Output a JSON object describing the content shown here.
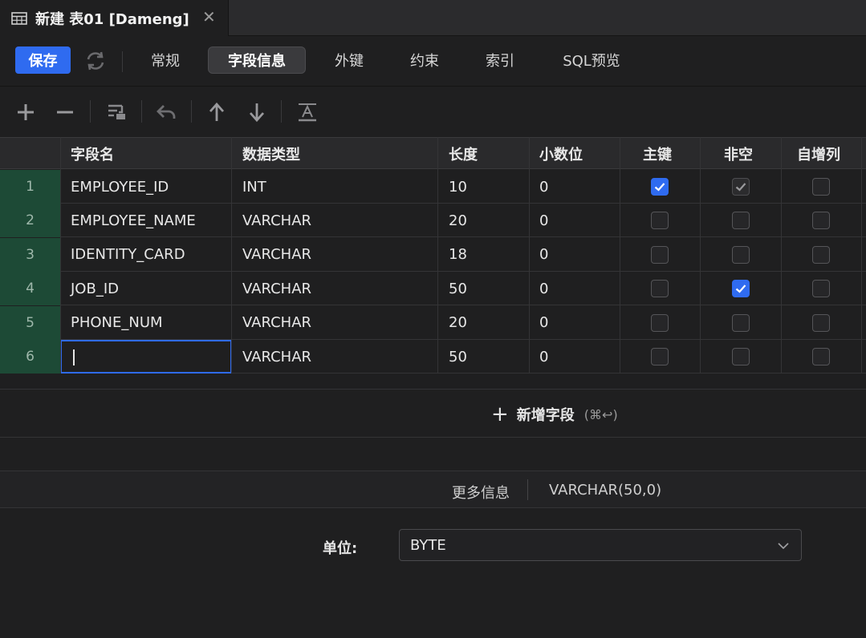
{
  "tab": {
    "title": "新建 表01 [Dameng]",
    "close": "✕"
  },
  "toolbar": {
    "save_label": "保存",
    "tabs": [
      "常规",
      "字段信息",
      "外键",
      "约束",
      "索引",
      "SQL预览"
    ],
    "active_tab": "字段信息"
  },
  "icons": [
    "add-icon",
    "remove-icon",
    "insert-row-icon",
    "undo-icon",
    "move-up-icon",
    "move-down-icon",
    "text-format-icon"
  ],
  "grid": {
    "headers": [
      "字段名",
      "数据类型",
      "长度",
      "小数位",
      "主键",
      "非空",
      "自增列"
    ],
    "rows": [
      {
        "num": "1",
        "name": "EMPLOYEE_ID",
        "type": "INT",
        "length": "10",
        "scale": "0",
        "pk": true,
        "notnull": true,
        "notnull_style": "grey",
        "autoinc": false
      },
      {
        "num": "2",
        "name": "EMPLOYEE_NAME",
        "type": "VARCHAR",
        "length": "20",
        "scale": "0",
        "pk": false,
        "notnull": false,
        "autoinc": false
      },
      {
        "num": "3",
        "name": "IDENTITY_CARD",
        "type": "VARCHAR",
        "length": "18",
        "scale": "0",
        "pk": false,
        "notnull": false,
        "autoinc": false
      },
      {
        "num": "4",
        "name": "JOB_ID",
        "type": "VARCHAR",
        "length": "50",
        "scale": "0",
        "pk": false,
        "notnull": true,
        "autoinc": false
      },
      {
        "num": "5",
        "name": "PHONE_NUM",
        "type": "VARCHAR",
        "length": "20",
        "scale": "0",
        "pk": false,
        "notnull": false,
        "autoinc": false
      },
      {
        "num": "6",
        "name": "",
        "type": "VARCHAR",
        "length": "50",
        "scale": "0",
        "pk": false,
        "notnull": false,
        "autoinc": false
      }
    ]
  },
  "add_field": {
    "label": "新增字段",
    "shortcut": "(⌘↩)"
  },
  "info": {
    "label": "更多信息",
    "type": "VARCHAR(50,0)"
  },
  "unit": {
    "label": "单位:",
    "value": "BYTE"
  },
  "colors": {
    "accent": "#2f6bf0",
    "rownum_bg": "#1d4a36"
  }
}
